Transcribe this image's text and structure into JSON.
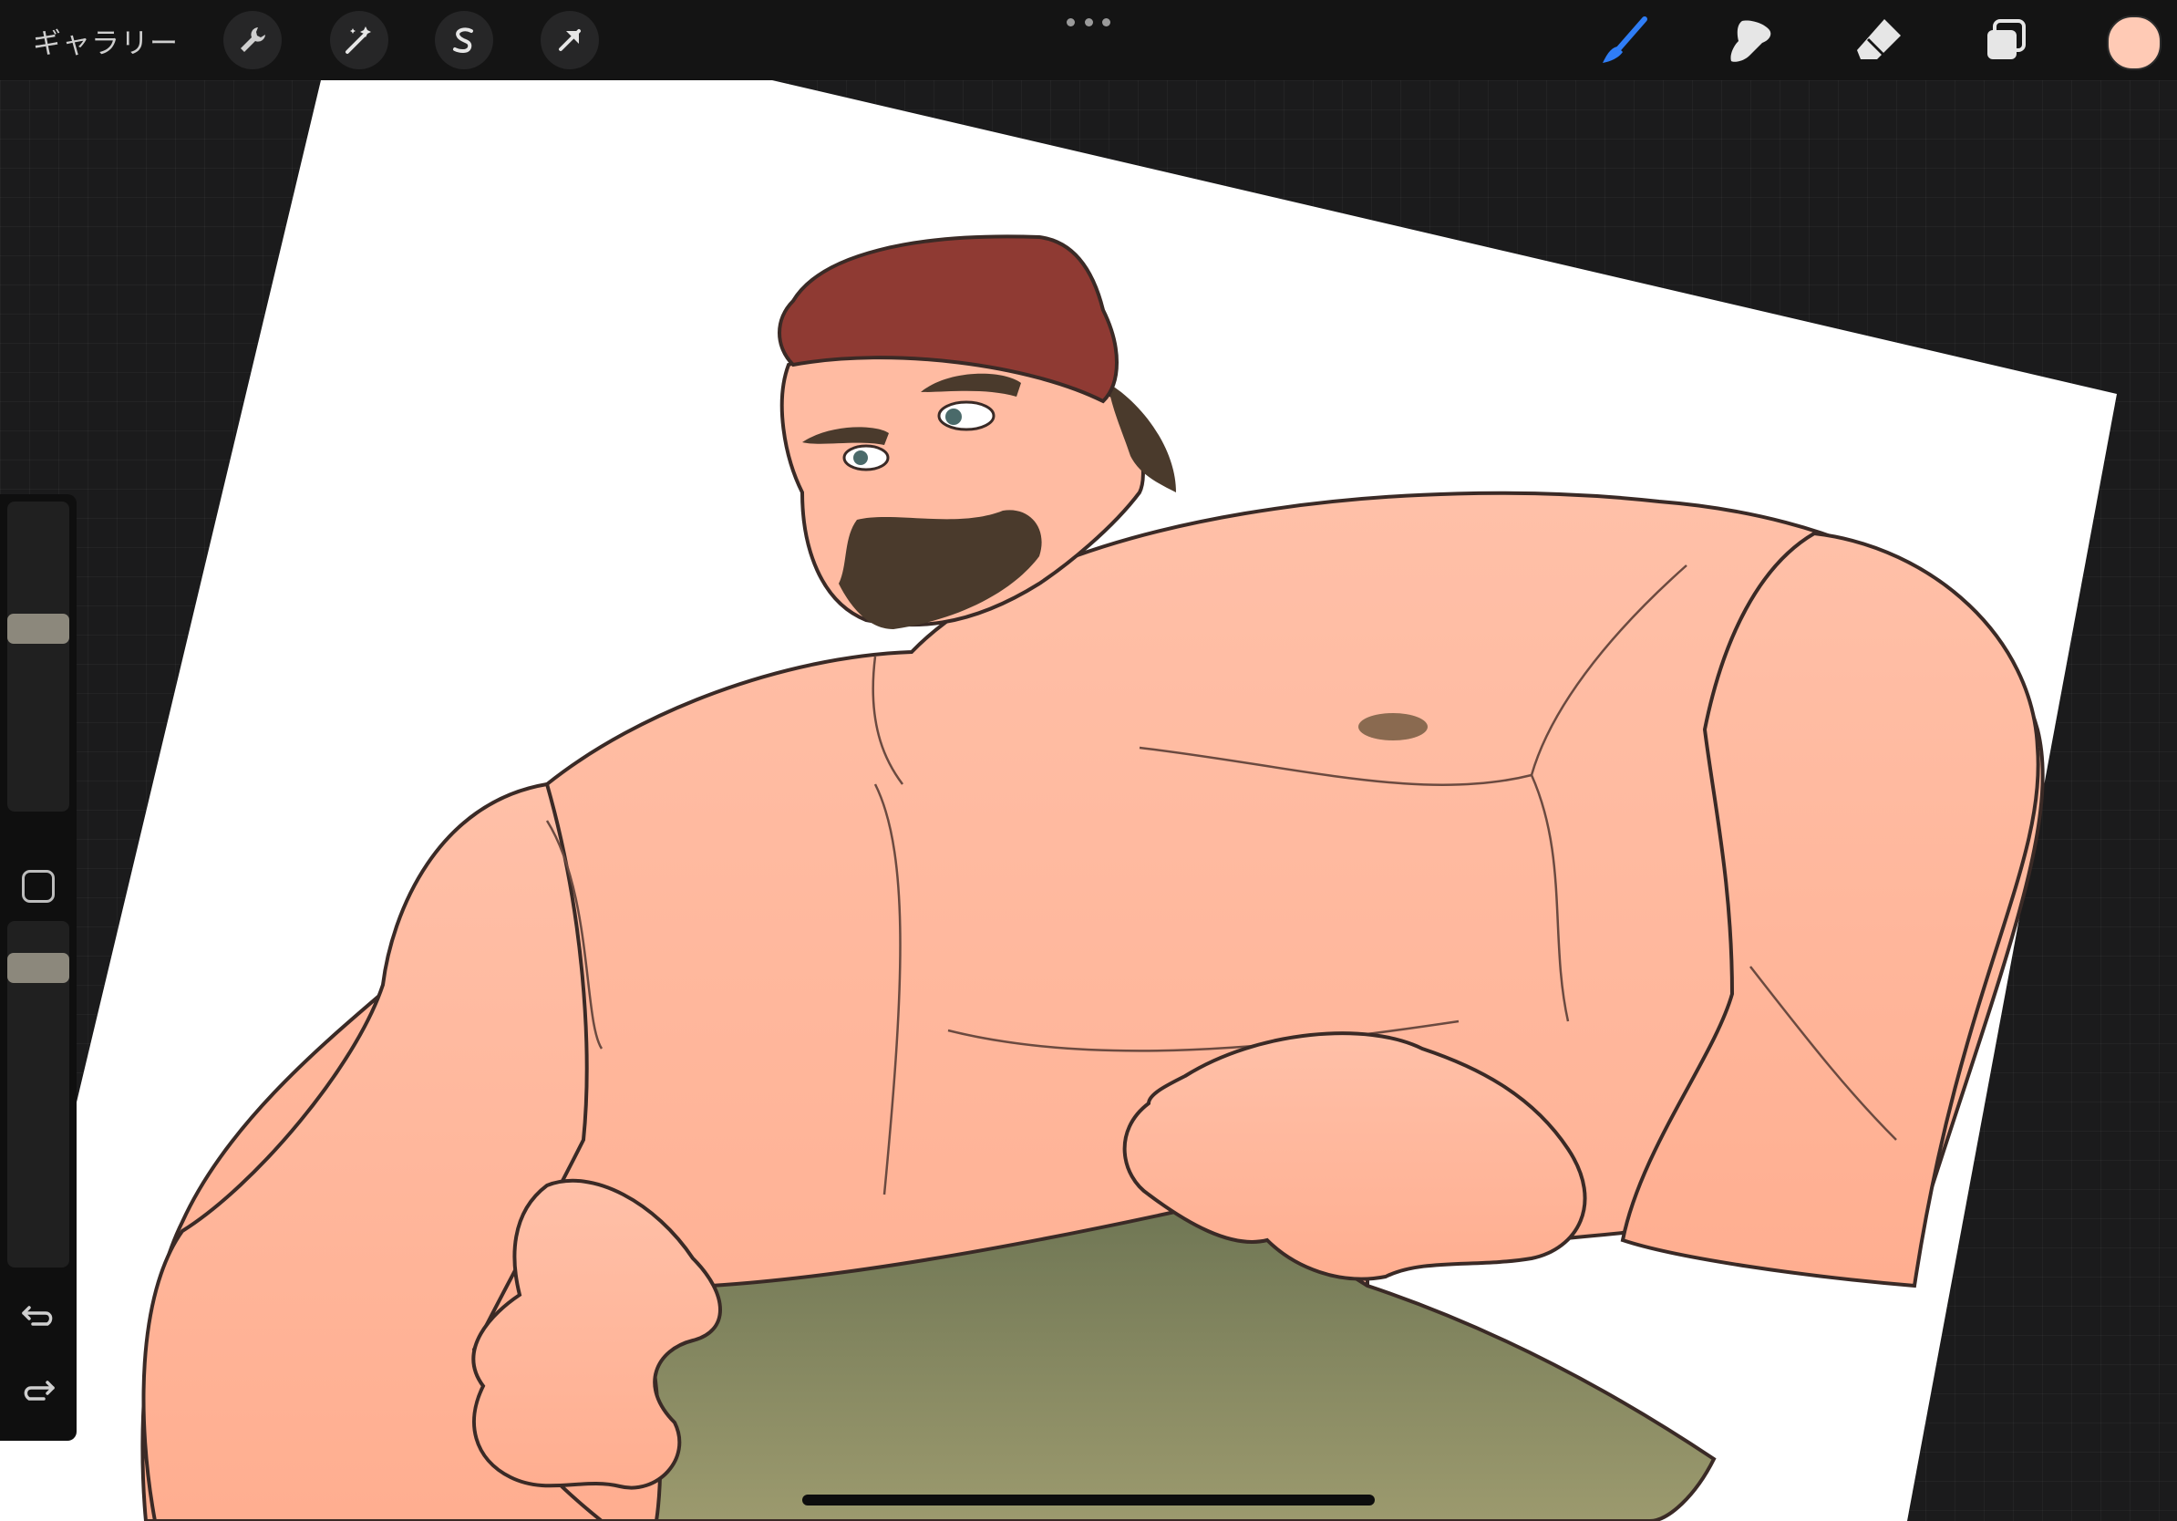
{
  "toolbar": {
    "gallery_label": "ギャラリー",
    "left_tools": [
      {
        "name": "actions",
        "icon": "wrench-icon"
      },
      {
        "name": "adjustments",
        "icon": "magic-wand-icon"
      },
      {
        "name": "selection",
        "icon": "selection-s-icon"
      },
      {
        "name": "transform",
        "icon": "arrow-cursor-icon"
      }
    ],
    "more_icon": "more-dots-icon",
    "right_tools": [
      {
        "name": "brush",
        "icon": "brush-icon",
        "active": true
      },
      {
        "name": "smudge",
        "icon": "smudge-finger-icon",
        "active": false
      },
      {
        "name": "eraser",
        "icon": "eraser-icon",
        "active": false
      },
      {
        "name": "layers",
        "icon": "layers-icon",
        "active": false
      }
    ],
    "active_color": "#ffcab5",
    "accent_color": "#2f7df6"
  },
  "sidebar": {
    "brush_size_level": 0.6,
    "opacity_level": 0.9,
    "undo_icon": "undo-icon",
    "redo_icon": "redo-icon",
    "modify_icon": "square-modify-icon"
  },
  "canvas": {
    "artwork": "illustration",
    "paper_color": "#ffffff",
    "skin_color": "#ffbba2",
    "bandana_color": "#8f3a33",
    "hair_color": "#4a3a2c",
    "cloth_color": "#8a8c66"
  }
}
